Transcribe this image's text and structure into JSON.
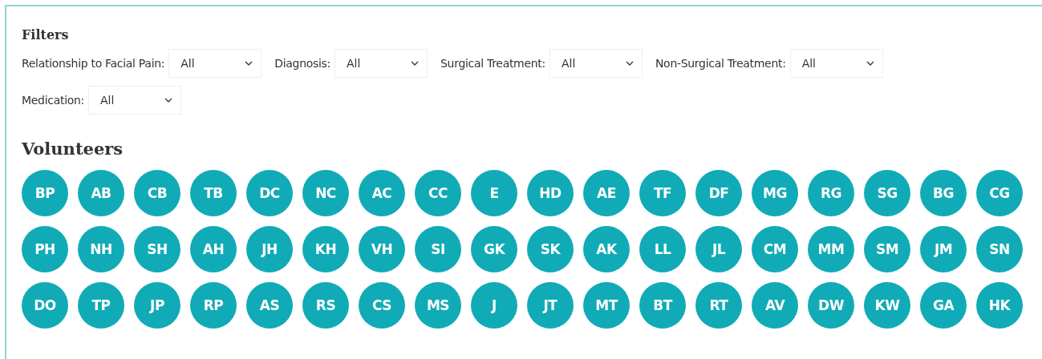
{
  "filters": {
    "title": "Filters",
    "items": [
      {
        "label": "Relationship to Facial Pain:",
        "value": "All"
      },
      {
        "label": "Diagnosis:",
        "value": "All"
      },
      {
        "label": "Surgical Treatment:",
        "value": "All"
      },
      {
        "label": "Non-Surgical Treatment:",
        "value": "All"
      },
      {
        "label": "Medication:",
        "value": "All"
      }
    ]
  },
  "volunteers": {
    "title": "Volunteers",
    "items": [
      "BP",
      "AB",
      "CB",
      "TB",
      "DC",
      "NC",
      "AC",
      "CC",
      "E",
      "HD",
      "AE",
      "TF",
      "DF",
      "MG",
      "RG",
      "SG",
      "BG",
      "CG",
      "PH",
      "NH",
      "SH",
      "AH",
      "JH",
      "KH",
      "VH",
      "SI",
      "GK",
      "SK",
      "AK",
      "LL",
      "JL",
      "CM",
      "MM",
      "SM",
      "JM",
      "SN",
      "DO",
      "TP",
      "JP",
      "RP",
      "AS",
      "RS",
      "CS",
      "MS",
      "J",
      "JT",
      "MT",
      "BT",
      "RT",
      "AV",
      "DW",
      "KW",
      "GA",
      "HK"
    ]
  }
}
